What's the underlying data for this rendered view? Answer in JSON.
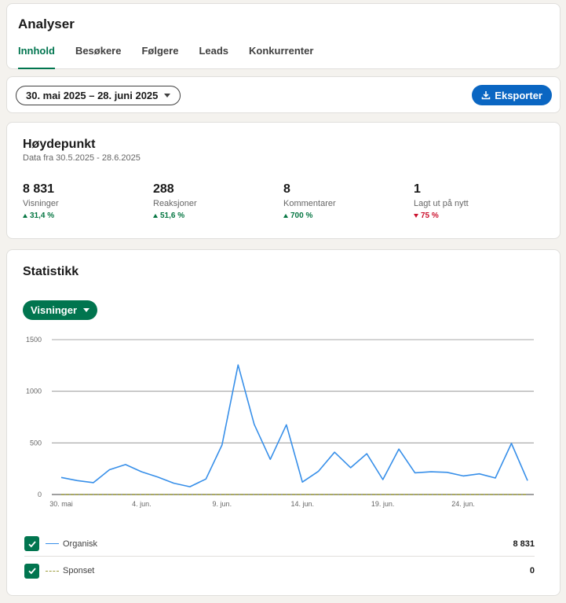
{
  "header": {
    "title": "Analyser",
    "tabs": [
      {
        "label": "Innhold"
      },
      {
        "label": "Besøkere"
      },
      {
        "label": "Følgere"
      },
      {
        "label": "Leads"
      },
      {
        "label": "Konkurrenter"
      }
    ]
  },
  "toolbar": {
    "date_range": "30. mai 2025 – 28. juni 2025",
    "export_label": "Eksporter"
  },
  "highlights": {
    "title": "Høydepunkt",
    "subtitle": "Data fra 30.5.2025 - 28.6.2025",
    "metrics": [
      {
        "value": "8 831",
        "label": "Visninger",
        "change": "31,4 %",
        "direction": "up"
      },
      {
        "value": "288",
        "label": "Reaksjoner",
        "change": "51,6 %",
        "direction": "up"
      },
      {
        "value": "8",
        "label": "Kommentarer",
        "change": "700 %",
        "direction": "up"
      },
      {
        "value": "1",
        "label": "Lagt ut på nytt",
        "change": "75 %",
        "direction": "down"
      }
    ]
  },
  "statistics": {
    "title": "Statistikk",
    "metric_selector": "Visninger",
    "legend": [
      {
        "name": "Organisk",
        "total": "8 831"
      },
      {
        "name": "Sponset",
        "total": "0"
      }
    ]
  },
  "chart_data": {
    "type": "line",
    "x": [
      "30. mai",
      "31. mai",
      "1. jun.",
      "2. jun.",
      "3. jun.",
      "4. jun.",
      "5. jun.",
      "6. jun.",
      "7. jun.",
      "8. jun.",
      "9. jun.",
      "10. jun.",
      "11. jun.",
      "12. jun.",
      "13. jun.",
      "14. jun.",
      "15. jun.",
      "16. jun.",
      "17. jun.",
      "18. jun.",
      "19. jun.",
      "20. jun.",
      "21. jun.",
      "22. jun.",
      "23. jun.",
      "24. jun.",
      "25. jun.",
      "26. jun.",
      "27. jun.",
      "28. jun."
    ],
    "x_tick_labels": [
      "30. mai",
      "4. jun.",
      "9. jun.",
      "14. jun.",
      "19. jun.",
      "24. jun."
    ],
    "series": [
      {
        "name": "Organisk",
        "color": "#378fe9",
        "style": "solid",
        "values": [
          165,
          135,
          115,
          240,
          290,
          220,
          170,
          110,
          75,
          150,
          480,
          1255,
          680,
          340,
          675,
          120,
          225,
          410,
          260,
          395,
          145,
          440,
          210,
          220,
          215,
          180,
          200,
          160,
          495,
          135
        ]
      },
      {
        "name": "Sponset",
        "color": "#9a9a3a",
        "style": "dashed",
        "values": [
          0,
          0,
          0,
          0,
          0,
          0,
          0,
          0,
          0,
          0,
          0,
          0,
          0,
          0,
          0,
          0,
          0,
          0,
          0,
          0,
          0,
          0,
          0,
          0,
          0,
          0,
          0,
          0,
          0,
          0
        ]
      }
    ],
    "y_ticks": [
      0,
      500,
      1000,
      1500
    ],
    "ylim": [
      0,
      1500
    ],
    "grid": true
  }
}
